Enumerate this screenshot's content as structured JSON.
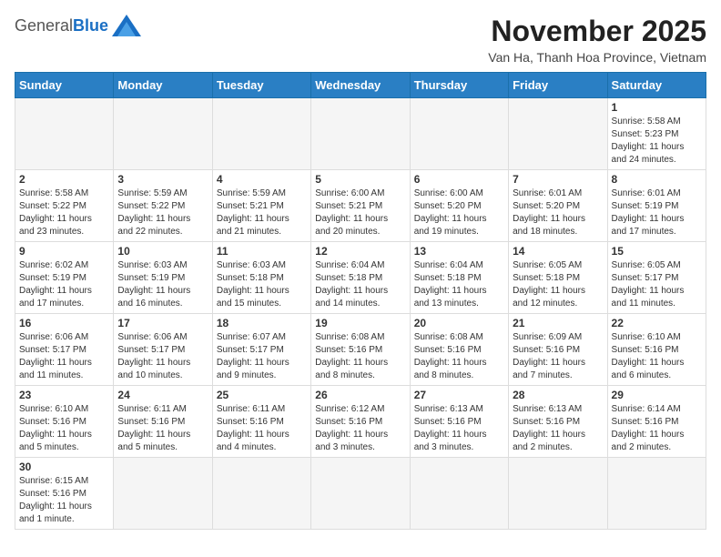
{
  "header": {
    "logo_general": "General",
    "logo_blue": "Blue",
    "month_title": "November 2025",
    "location": "Van Ha, Thanh Hoa Province, Vietnam"
  },
  "weekdays": [
    "Sunday",
    "Monday",
    "Tuesday",
    "Wednesday",
    "Thursday",
    "Friday",
    "Saturday"
  ],
  "weeks": [
    [
      {
        "day": "",
        "info": ""
      },
      {
        "day": "",
        "info": ""
      },
      {
        "day": "",
        "info": ""
      },
      {
        "day": "",
        "info": ""
      },
      {
        "day": "",
        "info": ""
      },
      {
        "day": "",
        "info": ""
      },
      {
        "day": "1",
        "info": "Sunrise: 5:58 AM\nSunset: 5:23 PM\nDaylight: 11 hours\nand 24 minutes."
      }
    ],
    [
      {
        "day": "2",
        "info": "Sunrise: 5:58 AM\nSunset: 5:22 PM\nDaylight: 11 hours\nand 23 minutes."
      },
      {
        "day": "3",
        "info": "Sunrise: 5:59 AM\nSunset: 5:22 PM\nDaylight: 11 hours\nand 22 minutes."
      },
      {
        "day": "4",
        "info": "Sunrise: 5:59 AM\nSunset: 5:21 PM\nDaylight: 11 hours\nand 21 minutes."
      },
      {
        "day": "5",
        "info": "Sunrise: 6:00 AM\nSunset: 5:21 PM\nDaylight: 11 hours\nand 20 minutes."
      },
      {
        "day": "6",
        "info": "Sunrise: 6:00 AM\nSunset: 5:20 PM\nDaylight: 11 hours\nand 19 minutes."
      },
      {
        "day": "7",
        "info": "Sunrise: 6:01 AM\nSunset: 5:20 PM\nDaylight: 11 hours\nand 18 minutes."
      },
      {
        "day": "8",
        "info": "Sunrise: 6:01 AM\nSunset: 5:19 PM\nDaylight: 11 hours\nand 17 minutes."
      }
    ],
    [
      {
        "day": "9",
        "info": "Sunrise: 6:02 AM\nSunset: 5:19 PM\nDaylight: 11 hours\nand 17 minutes."
      },
      {
        "day": "10",
        "info": "Sunrise: 6:03 AM\nSunset: 5:19 PM\nDaylight: 11 hours\nand 16 minutes."
      },
      {
        "day": "11",
        "info": "Sunrise: 6:03 AM\nSunset: 5:18 PM\nDaylight: 11 hours\nand 15 minutes."
      },
      {
        "day": "12",
        "info": "Sunrise: 6:04 AM\nSunset: 5:18 PM\nDaylight: 11 hours\nand 14 minutes."
      },
      {
        "day": "13",
        "info": "Sunrise: 6:04 AM\nSunset: 5:18 PM\nDaylight: 11 hours\nand 13 minutes."
      },
      {
        "day": "14",
        "info": "Sunrise: 6:05 AM\nSunset: 5:18 PM\nDaylight: 11 hours\nand 12 minutes."
      },
      {
        "day": "15",
        "info": "Sunrise: 6:05 AM\nSunset: 5:17 PM\nDaylight: 11 hours\nand 11 minutes."
      }
    ],
    [
      {
        "day": "16",
        "info": "Sunrise: 6:06 AM\nSunset: 5:17 PM\nDaylight: 11 hours\nand 11 minutes."
      },
      {
        "day": "17",
        "info": "Sunrise: 6:06 AM\nSunset: 5:17 PM\nDaylight: 11 hours\nand 10 minutes."
      },
      {
        "day": "18",
        "info": "Sunrise: 6:07 AM\nSunset: 5:17 PM\nDaylight: 11 hours\nand 9 minutes."
      },
      {
        "day": "19",
        "info": "Sunrise: 6:08 AM\nSunset: 5:16 PM\nDaylight: 11 hours\nand 8 minutes."
      },
      {
        "day": "20",
        "info": "Sunrise: 6:08 AM\nSunset: 5:16 PM\nDaylight: 11 hours\nand 8 minutes."
      },
      {
        "day": "21",
        "info": "Sunrise: 6:09 AM\nSunset: 5:16 PM\nDaylight: 11 hours\nand 7 minutes."
      },
      {
        "day": "22",
        "info": "Sunrise: 6:10 AM\nSunset: 5:16 PM\nDaylight: 11 hours\nand 6 minutes."
      }
    ],
    [
      {
        "day": "23",
        "info": "Sunrise: 6:10 AM\nSunset: 5:16 PM\nDaylight: 11 hours\nand 5 minutes."
      },
      {
        "day": "24",
        "info": "Sunrise: 6:11 AM\nSunset: 5:16 PM\nDaylight: 11 hours\nand 5 minutes."
      },
      {
        "day": "25",
        "info": "Sunrise: 6:11 AM\nSunset: 5:16 PM\nDaylight: 11 hours\nand 4 minutes."
      },
      {
        "day": "26",
        "info": "Sunrise: 6:12 AM\nSunset: 5:16 PM\nDaylight: 11 hours\nand 3 minutes."
      },
      {
        "day": "27",
        "info": "Sunrise: 6:13 AM\nSunset: 5:16 PM\nDaylight: 11 hours\nand 3 minutes."
      },
      {
        "day": "28",
        "info": "Sunrise: 6:13 AM\nSunset: 5:16 PM\nDaylight: 11 hours\nand 2 minutes."
      },
      {
        "day": "29",
        "info": "Sunrise: 6:14 AM\nSunset: 5:16 PM\nDaylight: 11 hours\nand 2 minutes."
      }
    ],
    [
      {
        "day": "30",
        "info": "Sunrise: 6:15 AM\nSunset: 5:16 PM\nDaylight: 11 hours\nand 1 minute."
      },
      {
        "day": "",
        "info": ""
      },
      {
        "day": "",
        "info": ""
      },
      {
        "day": "",
        "info": ""
      },
      {
        "day": "",
        "info": ""
      },
      {
        "day": "",
        "info": ""
      },
      {
        "day": "",
        "info": ""
      }
    ]
  ]
}
